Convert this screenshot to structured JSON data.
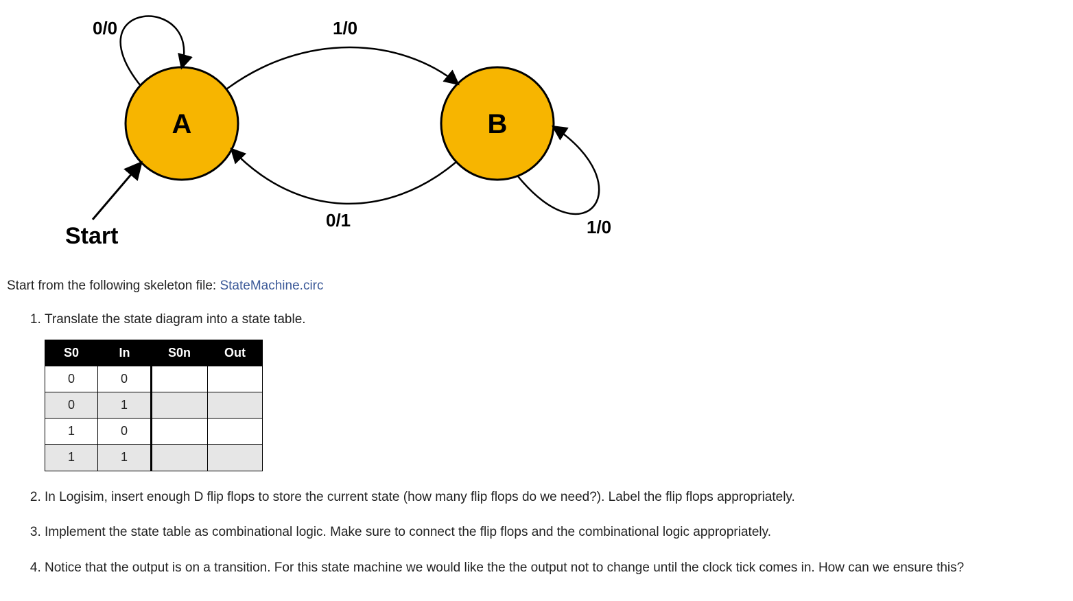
{
  "diagram": {
    "state_a_label": "A",
    "state_b_label": "B",
    "start_label": "Start",
    "loop_a_label": "0/0",
    "a_to_b_label": "1/0",
    "b_to_a_label": "0/1",
    "loop_b_label": "1/0"
  },
  "intro": {
    "prefix": "Start from the following skeleton file: ",
    "link_text": "StateMachine.circ"
  },
  "steps": {
    "s1": "Translate the state diagram into a state table.",
    "s2": "In Logisim, insert enough D flip flops to store the current state (how many flip flops do we need?). Label the flip flops appropriately.",
    "s3": "Implement the state table as combinational logic. Make sure to connect the flip flops and the combinational logic appropriately.",
    "s4": "Notice that the output is on a transition. For this state machine we would like the the output not to change until the clock tick comes in. How can we ensure this?"
  },
  "table": {
    "headers": {
      "c0": "S0",
      "c1": "In",
      "c2": "S0n",
      "c3": "Out"
    },
    "rows": [
      {
        "s0": "0",
        "in": "0",
        "s0n": "",
        "out": ""
      },
      {
        "s0": "0",
        "in": "1",
        "s0n": "",
        "out": ""
      },
      {
        "s0": "1",
        "in": "0",
        "s0n": "",
        "out": ""
      },
      {
        "s0": "1",
        "in": "1",
        "s0n": "",
        "out": ""
      }
    ]
  }
}
